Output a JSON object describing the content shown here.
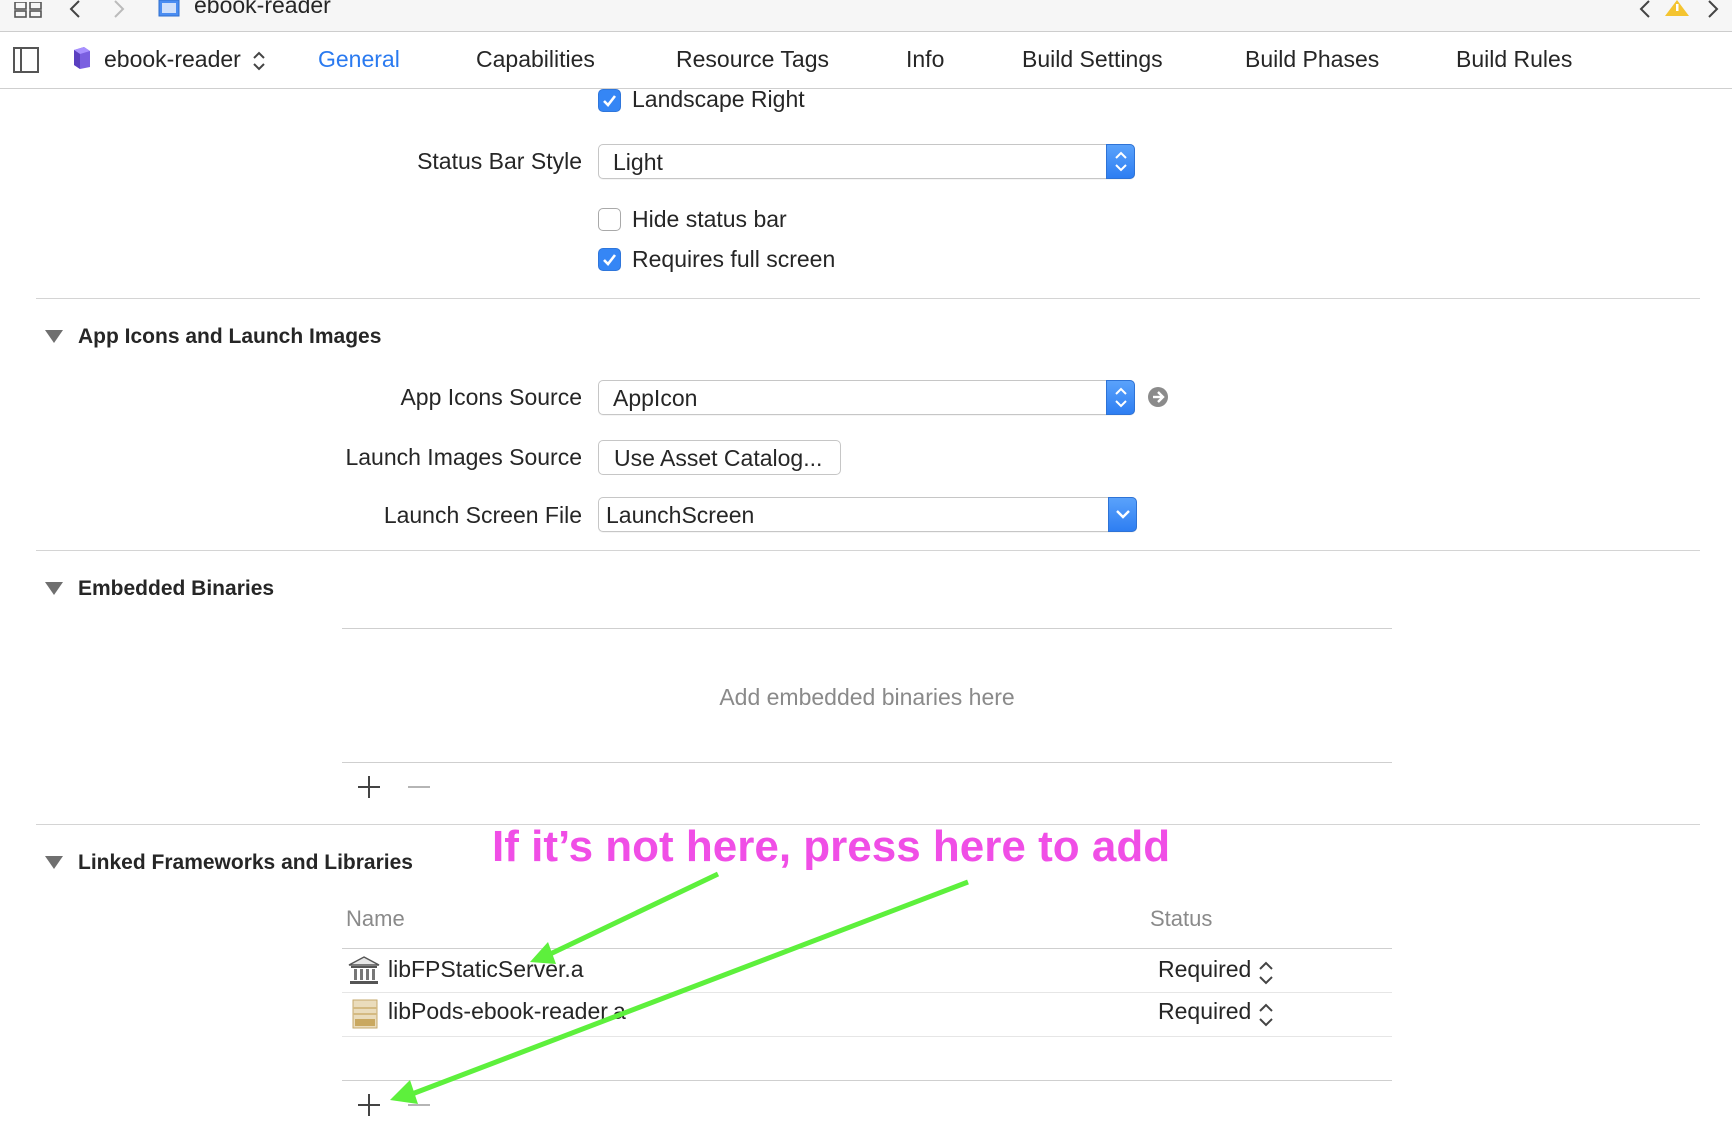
{
  "colors": {
    "accent": "#2a7af0",
    "checkbox_blue": "#3586f5",
    "annotation_pink": "#f04ee6",
    "arrow_green": "#5df03c",
    "warning_yellow": "#f4c430"
  },
  "toolbar": {
    "project_name": "ebook-reader",
    "icons": [
      "grid-icon",
      "back-chevron-icon",
      "forward-chevron-icon",
      "project-file-icon",
      "warning-icon"
    ]
  },
  "tabbar": {
    "target_name": "ebook-reader",
    "tabs": [
      {
        "label": "General",
        "active": true
      },
      {
        "label": "Capabilities",
        "active": false
      },
      {
        "label": "Resource Tags",
        "active": false
      },
      {
        "label": "Info",
        "active": false
      },
      {
        "label": "Build Settings",
        "active": false
      },
      {
        "label": "Build Phases",
        "active": false
      },
      {
        "label": "Build Rules",
        "active": false
      }
    ]
  },
  "deployment": {
    "landscape_right": {
      "label": "Landscape Right",
      "checked": true
    },
    "status_bar_style": {
      "label": "Status Bar Style",
      "value": "Light"
    },
    "hide_status_bar": {
      "label": "Hide status bar",
      "checked": false
    },
    "requires_full_screen": {
      "label": "Requires full screen",
      "checked": true
    }
  },
  "app_icons": {
    "title": "App Icons and Launch Images",
    "icons_source": {
      "label": "App Icons Source",
      "value": "AppIcon"
    },
    "launch_images_source": {
      "label": "Launch Images Source",
      "button": "Use Asset Catalog..."
    },
    "launch_screen_file": {
      "label": "Launch Screen File",
      "value": "LaunchScreen"
    }
  },
  "embedded": {
    "title": "Embedded Binaries",
    "placeholder": "Add embedded binaries here",
    "add": "+",
    "remove": "—"
  },
  "linked": {
    "title": "Linked Frameworks and Libraries",
    "columns": {
      "name": "Name",
      "status": "Status"
    },
    "rows": [
      {
        "name": "libFPStaticServer.a",
        "status": "Required",
        "icon": "library-icon"
      },
      {
        "name": "libPods-ebook-reader.a",
        "status": "Required",
        "icon": "archive-icon"
      }
    ],
    "add": "+",
    "remove": "—"
  },
  "annotation": {
    "text": "If it’s not here, press here to add"
  }
}
